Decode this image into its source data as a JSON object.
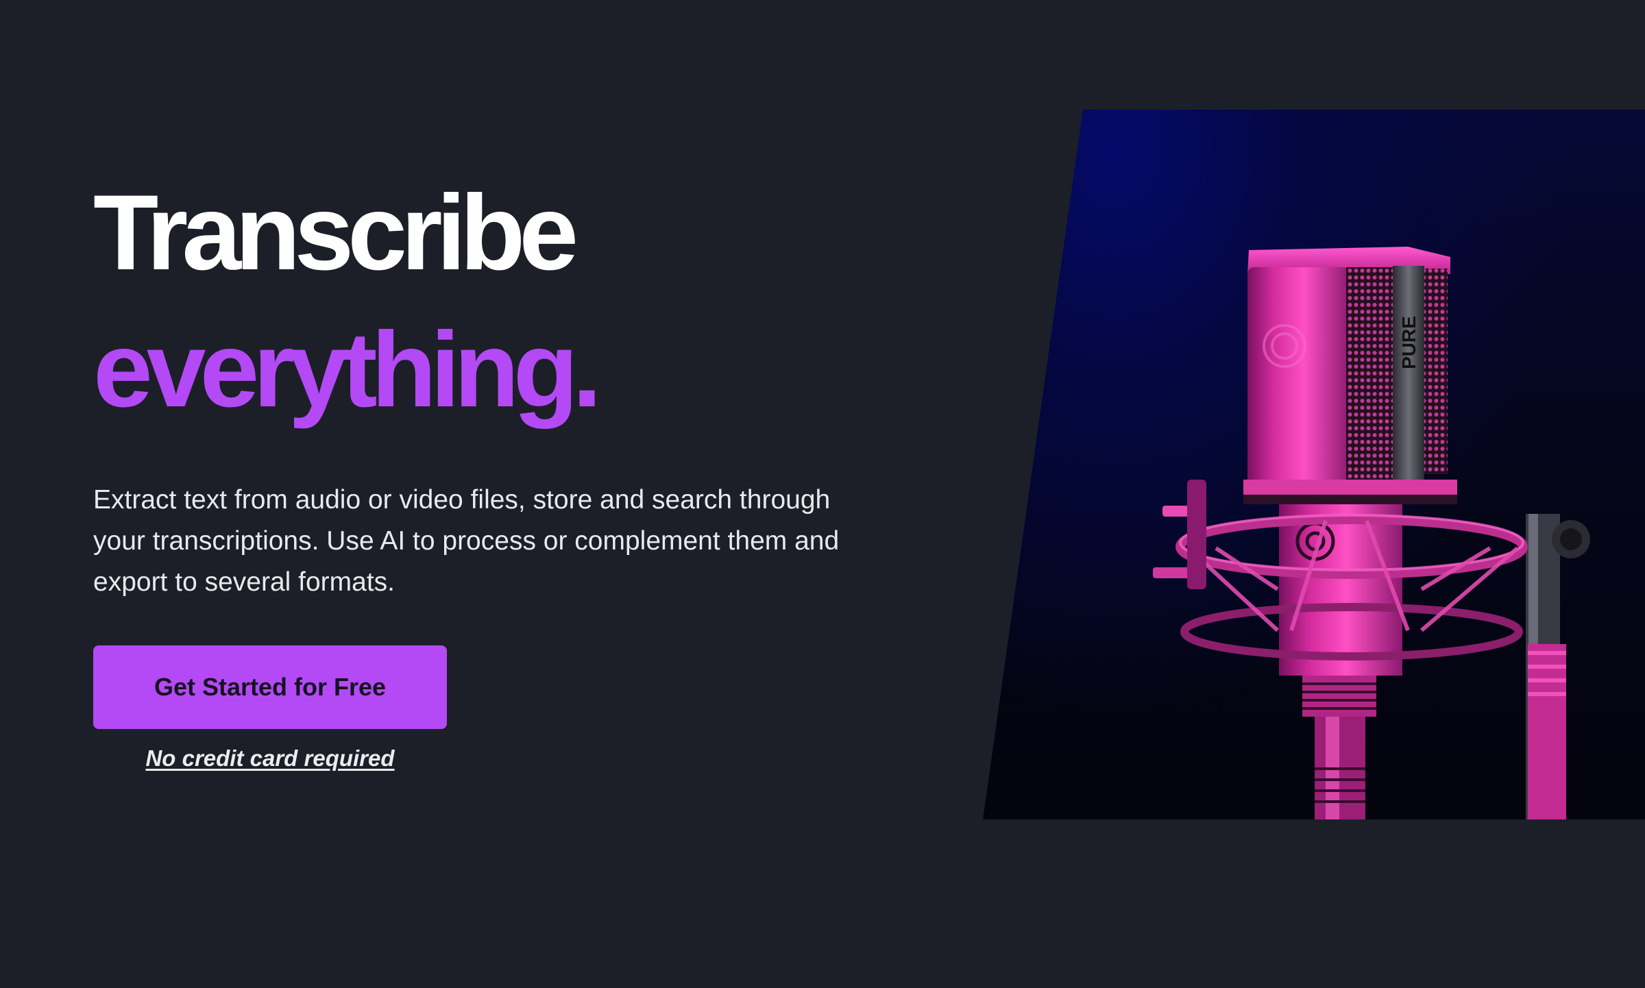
{
  "hero": {
    "headline_line1": "Transcribe",
    "headline_line2": "everything.",
    "subtitle": "Extract text from audio or video files, store and search through your transcriptions. Use AI to process or complement them and export to several formats.",
    "cta_label": "Get Started for Free",
    "cta_note": "No credit card required"
  },
  "image": {
    "subject": "microphone-photo",
    "mic_label": "PURE"
  },
  "colors": {
    "background": "#1c1f28",
    "accent": "#b34af5",
    "headline": "#ffffff",
    "body_text": "#e9e9ee"
  }
}
